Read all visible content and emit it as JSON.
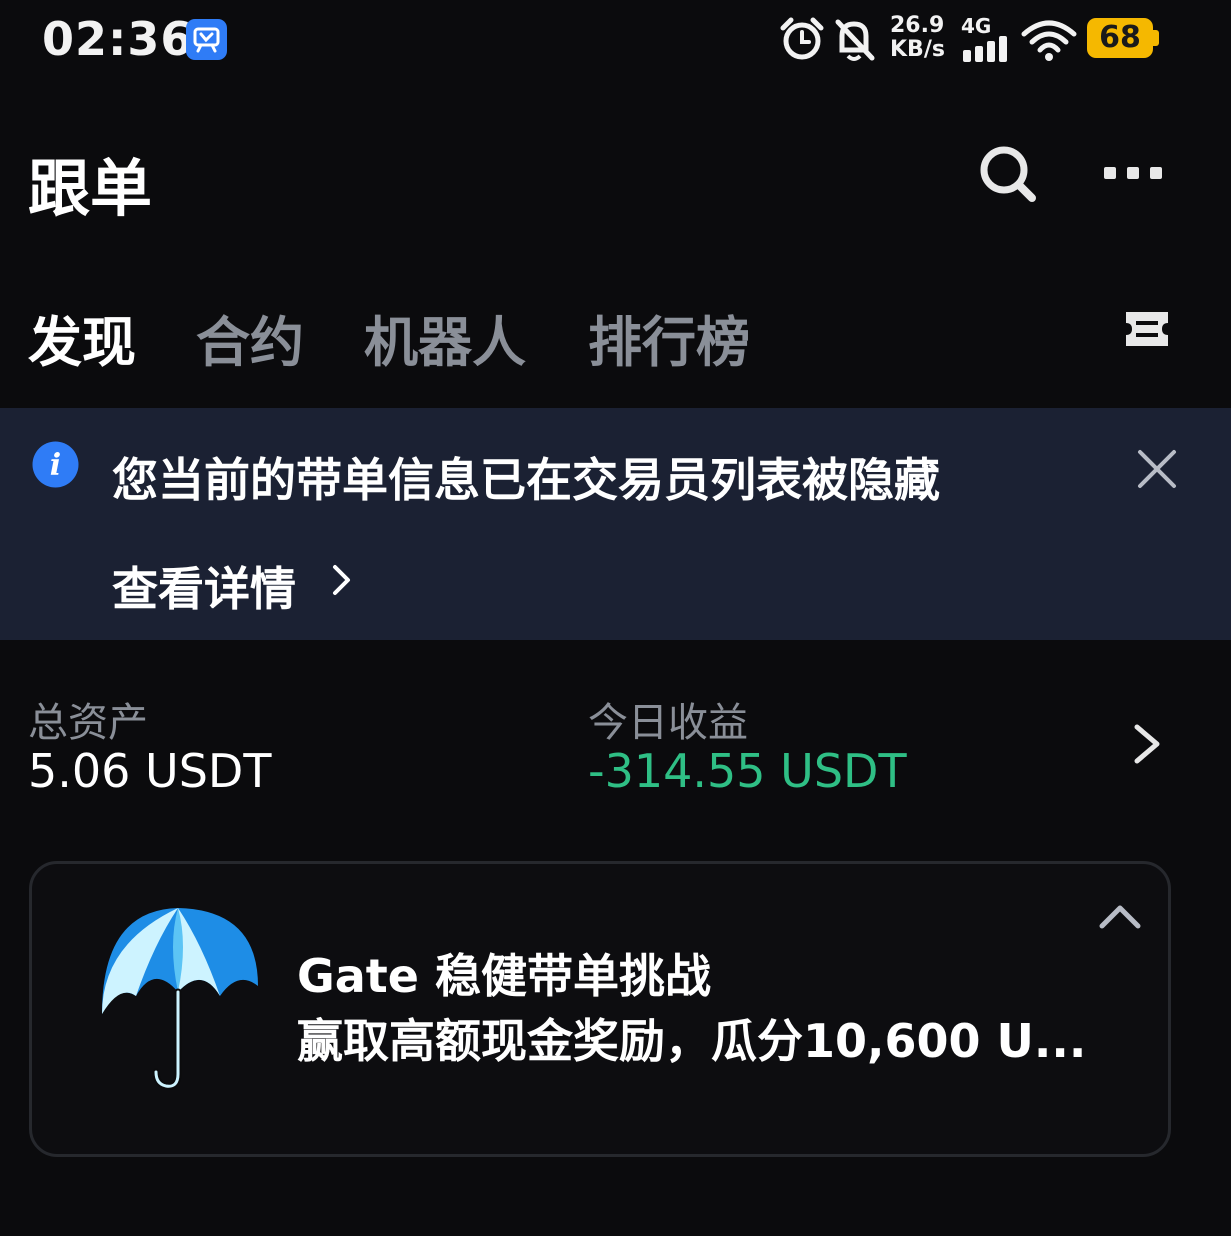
{
  "status_bar": {
    "time": "02:36",
    "net_speed_value": "26.9",
    "net_speed_unit": "KB/s",
    "network_type": "4G",
    "battery_level": "68",
    "colors": {
      "battery": "#f5b800",
      "app_badge": "#2f7cf6"
    }
  },
  "header": {
    "title": "跟单",
    "icons": [
      "search-icon",
      "more-icon"
    ]
  },
  "tabs": {
    "items": [
      {
        "label": "发现",
        "active": true
      },
      {
        "label": "合约",
        "active": false
      },
      {
        "label": "机器人",
        "active": false
      },
      {
        "label": "排行榜",
        "active": false
      }
    ],
    "right_icon": "ticket-icon"
  },
  "notice": {
    "message": "您当前的带单信息已在交易员列表被隐藏",
    "link_label": "查看详情",
    "background": "#1b2133"
  },
  "assets": {
    "total_label": "总资产",
    "total_value": "5.06 USDT",
    "today_label": "今日收益",
    "today_value": "-314.55 USDT",
    "today_color": "#2fbf85"
  },
  "promo": {
    "title": "Gate 稳健带单挑战",
    "subtitle": "赢取高额现金奖励，瓜分10,600 U..."
  }
}
